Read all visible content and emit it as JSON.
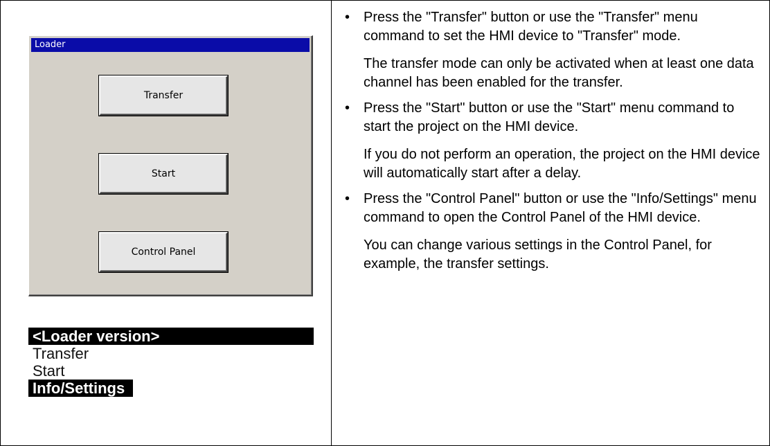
{
  "loader_window": {
    "title": "Loader",
    "buttons": [
      "Transfer",
      "Start",
      "Control Panel"
    ]
  },
  "menu": {
    "items": [
      "<Loader version>",
      "Transfer",
      "Start",
      "Info/Settings"
    ]
  },
  "instructions": {
    "bullet_glyph": "•",
    "items": [
      {
        "text": "Press the \"Transfer\" button or use the \"Transfer\" menu command to set the HMI device to \"Transfer\" mode.",
        "note": "The transfer mode can only be activated when at least one data channel has been enabled for the transfer."
      },
      {
        "text": "Press the \"Start\" button or use the \"Start\" menu command to start the project on the HMI device.",
        "note": "If you do not perform an operation, the project on the HMI device will automatically start after a delay."
      },
      {
        "text": "Press the \"Control Panel\" button or use the \"Info/Settings\" menu command to open the Control Panel of the HMI device.",
        "note": "You can change various settings in the Control Panel, for example, the transfer settings."
      }
    ]
  },
  "colors": {
    "titlebar": "#0a0ca8",
    "window_face": "#d4d0c8",
    "highlight": "#000000"
  }
}
